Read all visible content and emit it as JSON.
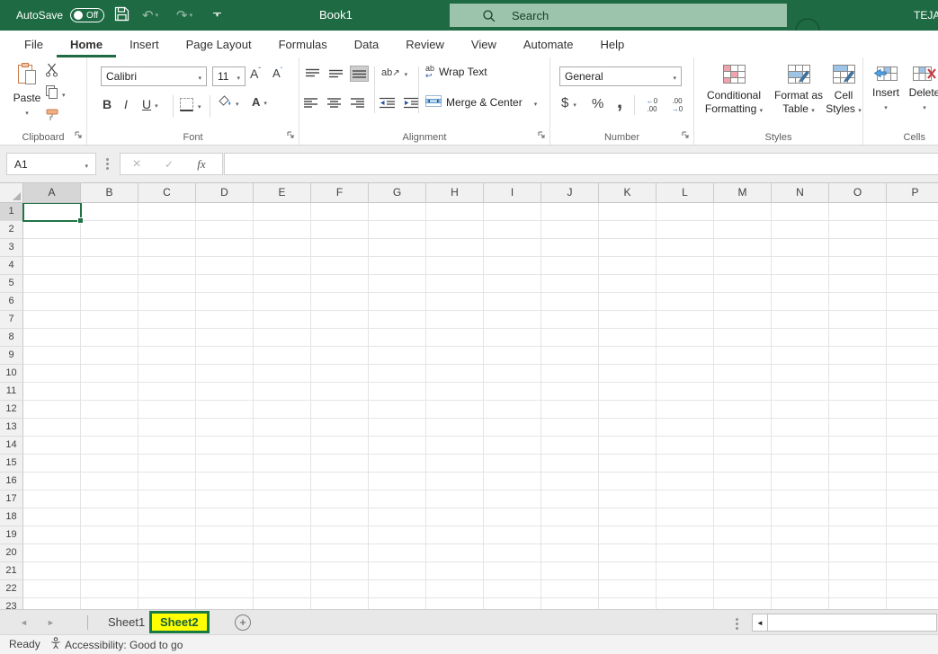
{
  "titlebar": {
    "autosave_label": "AutoSave",
    "autosave_state": "Off",
    "document_title": "Book1",
    "search_placeholder": "Search",
    "user_name": "TEJA"
  },
  "menu_tabs": {
    "items": [
      {
        "label": "File",
        "active": false
      },
      {
        "label": "Home",
        "active": true
      },
      {
        "label": "Insert",
        "active": false
      },
      {
        "label": "Page Layout",
        "active": false
      },
      {
        "label": "Formulas",
        "active": false
      },
      {
        "label": "Data",
        "active": false
      },
      {
        "label": "Review",
        "active": false
      },
      {
        "label": "View",
        "active": false
      },
      {
        "label": "Automate",
        "active": false
      },
      {
        "label": "Help",
        "active": false
      }
    ]
  },
  "ribbon": {
    "clipboard": {
      "group_label": "Clipboard",
      "paste_label": "Paste"
    },
    "font": {
      "group_label": "Font",
      "font_name": "Calibri",
      "font_size": "11",
      "bold": "B",
      "italic": "I",
      "underline": "U",
      "grow_font": "A",
      "shrink_font": "A",
      "font_color_letter": "A"
    },
    "alignment": {
      "group_label": "Alignment",
      "wrap_text_label": "Wrap Text",
      "merge_center_label": "Merge & Center",
      "orientation_text": "ab",
      "wrap_text_ab": "ab"
    },
    "number": {
      "group_label": "Number",
      "format": "General",
      "currency": "$",
      "percent": "%",
      "comma": ",",
      "increase_decimal": {
        "arrow": "←",
        "top_num": "0",
        "bottom": ".00"
      },
      "decrease_decimal": {
        "top": ".00",
        "arrow": "→",
        "bottom_num": "0"
      }
    },
    "styles": {
      "group_label": "Styles",
      "conditional_line1": "Conditional",
      "conditional_line2": "Formatting",
      "format_table_line1": "Format as",
      "format_table_line2": "Table",
      "cell_styles_line1": "Cell",
      "cell_styles_line2": "Styles"
    },
    "cells": {
      "group_label": "Cells",
      "insert_label": "Insert",
      "delete_label": "Delete"
    }
  },
  "formula_bar": {
    "name_box_value": "A1",
    "fx_label": "fx",
    "formula_value": ""
  },
  "grid": {
    "column_headers": [
      "A",
      "B",
      "C",
      "D",
      "E",
      "F",
      "G",
      "H",
      "I",
      "J",
      "K",
      "L",
      "M",
      "N",
      "O",
      "P"
    ],
    "row_count": 23,
    "selected_cell": "A1"
  },
  "sheet_bar": {
    "tabs": [
      {
        "label": "Sheet1",
        "active": false
      },
      {
        "label": "Sheet2",
        "active": true
      }
    ]
  },
  "status_bar": {
    "mode": "Ready",
    "accessibility_label": "Accessibility: Good to go"
  },
  "icons": {
    "undo": "↶",
    "redo": "↷",
    "dropdown_caret": "▾",
    "sheet_nav_left": "◄",
    "sheet_nav_right": "►",
    "scroll_left": "◄",
    "new_sheet_plus": "+"
  },
  "colors": {
    "title_green": "#1e6b43",
    "search_box_green": "#9cc3ab",
    "selection_green": "#217346",
    "active_sheet_highlight": "#ffff00",
    "active_sheet_border": "#1a7a44",
    "fill_color_swatch": "#ffe81a",
    "font_color_swatch": "#c00000"
  }
}
